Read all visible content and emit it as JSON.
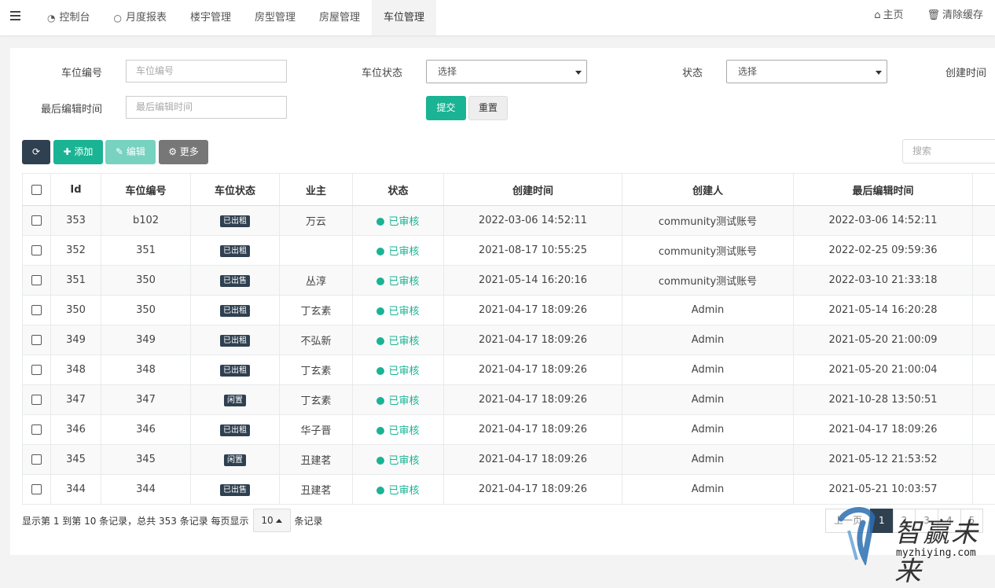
{
  "topbar": {
    "nav": [
      {
        "label": "控制台",
        "icon": "dashboard-icon"
      },
      {
        "label": "月度报表",
        "icon": "circle-icon"
      },
      {
        "label": "楼宇管理"
      },
      {
        "label": "房型管理"
      },
      {
        "label": "房屋管理"
      },
      {
        "label": "车位管理",
        "active": true
      }
    ],
    "home": "主页",
    "clear_cache": "清除缓存"
  },
  "filters": {
    "space_no_label": "车位编号",
    "space_no_placeholder": "车位编号",
    "space_status_label": "车位状态",
    "space_status_value": "选择",
    "status_label": "状态",
    "status_value": "选择",
    "created_label": "创建时间",
    "edited_label": "最后编辑时间",
    "edited_placeholder": "最后编辑时间",
    "submit": "提交",
    "reset": "重置"
  },
  "toolbar": {
    "add": "添加",
    "edit": "编辑",
    "more": "更多",
    "search_placeholder": "搜索"
  },
  "table": {
    "headers": [
      "Id",
      "车位编号",
      "车位状态",
      "业主",
      "状态",
      "创建时间",
      "创建人",
      "最后编辑时间"
    ],
    "rows": [
      {
        "id": "353",
        "no": "b102",
        "space_status": "已出租",
        "owner": "万云",
        "status": "已审核",
        "created": "2022-03-06 14:52:11",
        "creator": "community测试账号",
        "edited": "2022-03-06 14:52:11"
      },
      {
        "id": "352",
        "no": "351",
        "space_status": "已出租",
        "owner": "",
        "status": "已审核",
        "created": "2021-08-17 10:55:25",
        "creator": "community测试账号",
        "edited": "2022-02-25 09:59:36"
      },
      {
        "id": "351",
        "no": "350",
        "space_status": "已出售",
        "owner": "丛淳",
        "status": "已审核",
        "created": "2021-05-14 16:20:16",
        "creator": "community测试账号",
        "edited": "2022-03-10 21:33:18"
      },
      {
        "id": "350",
        "no": "350",
        "space_status": "已出租",
        "owner": "丁玄素",
        "status": "已审核",
        "created": "2021-04-17 18:09:26",
        "creator": "Admin",
        "edited": "2021-05-14 16:20:28"
      },
      {
        "id": "349",
        "no": "349",
        "space_status": "已出租",
        "owner": "不弘新",
        "status": "已审核",
        "created": "2021-04-17 18:09:26",
        "creator": "Admin",
        "edited": "2021-05-20 21:00:09"
      },
      {
        "id": "348",
        "no": "348",
        "space_status": "已出租",
        "owner": "丁玄素",
        "status": "已审核",
        "created": "2021-04-17 18:09:26",
        "creator": "Admin",
        "edited": "2021-05-20 21:00:04"
      },
      {
        "id": "347",
        "no": "347",
        "space_status": "闲置",
        "owner": "丁玄素",
        "status": "已审核",
        "created": "2021-04-17 18:09:26",
        "creator": "Admin",
        "edited": "2021-10-28 13:50:51"
      },
      {
        "id": "346",
        "no": "346",
        "space_status": "已出租",
        "owner": "华子晋",
        "status": "已审核",
        "created": "2021-04-17 18:09:26",
        "creator": "Admin",
        "edited": "2021-04-17 18:09:26"
      },
      {
        "id": "345",
        "no": "345",
        "space_status": "闲置",
        "owner": "丑建茗",
        "status": "已审核",
        "created": "2021-04-17 18:09:26",
        "creator": "Admin",
        "edited": "2021-05-12 21:53:52"
      },
      {
        "id": "344",
        "no": "344",
        "space_status": "已出售",
        "owner": "丑建茗",
        "status": "已审核",
        "created": "2021-04-17 18:09:26",
        "creator": "Admin",
        "edited": "2021-05-21 10:03:57"
      }
    ]
  },
  "footer": {
    "summary": "显示第 1 到第 10 条记录，总共 353 条记录 每页显示",
    "page_size": "10",
    "suffix": "条记录"
  },
  "pager": {
    "prev": "上一页",
    "pages": [
      "1",
      "2",
      "3",
      "4",
      "5"
    ]
  },
  "watermark": {
    "text": "智赢未来",
    "url": "myzhiying.com"
  },
  "colors": {
    "accent": "#1ab394",
    "dark": "#2f4050"
  }
}
